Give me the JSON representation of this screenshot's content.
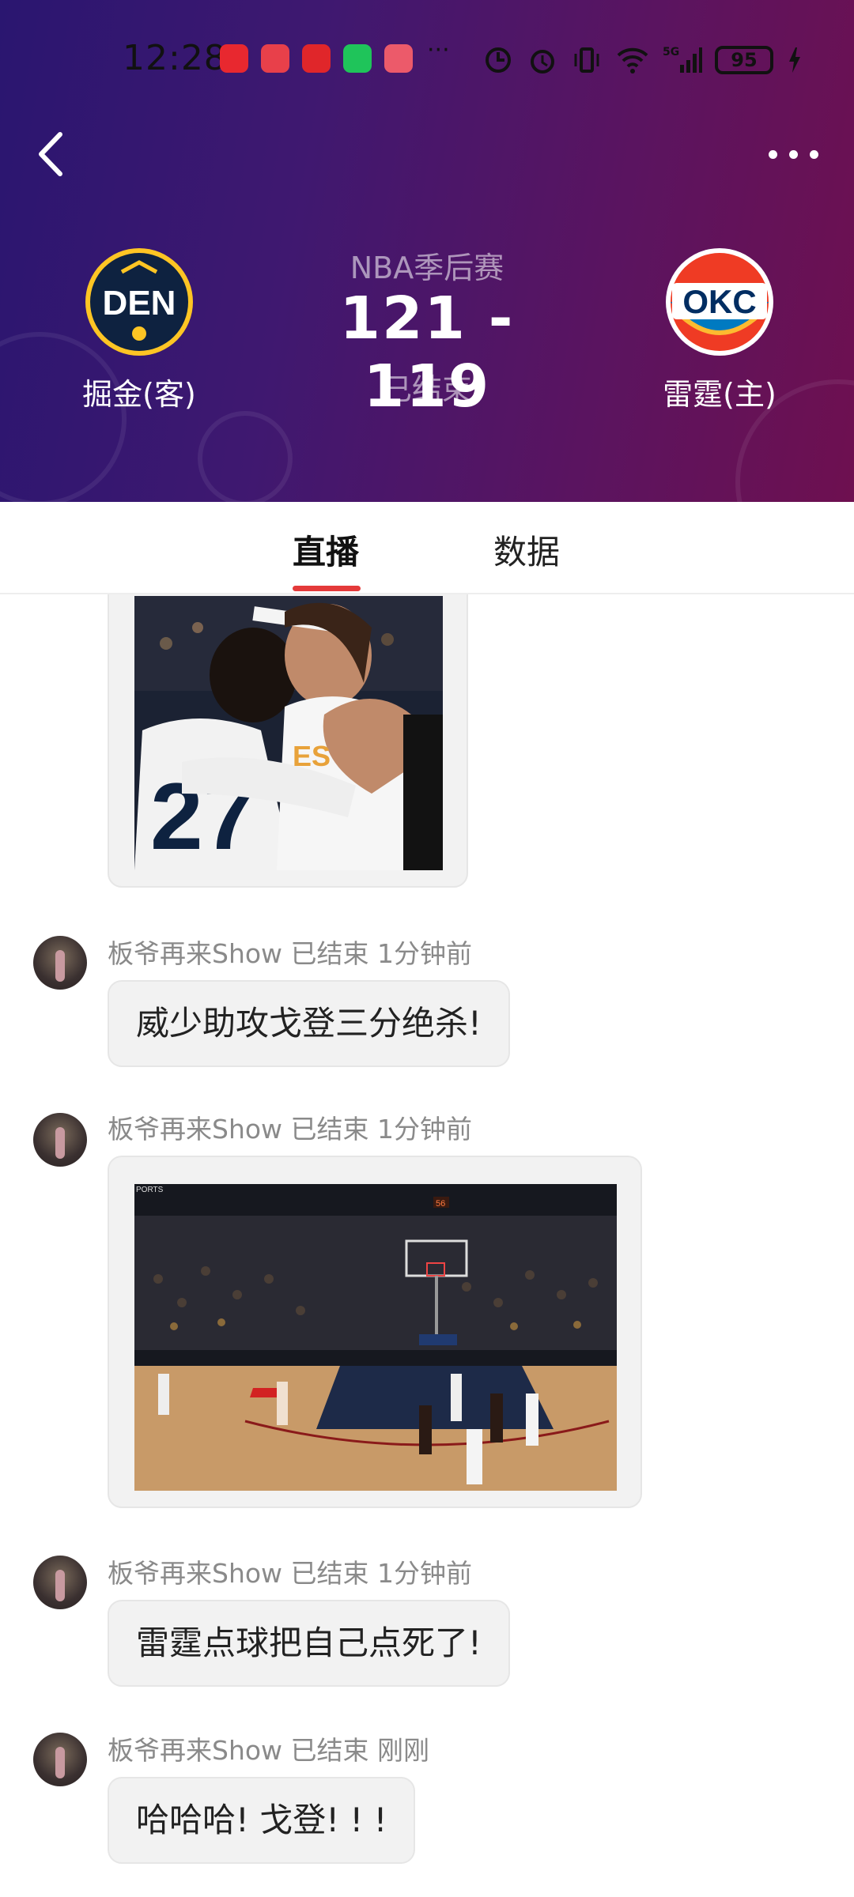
{
  "status_bar": {
    "time": "12:28",
    "dots": "···",
    "network": "5G",
    "battery": "95"
  },
  "header": {
    "league": "NBA季后赛",
    "score": "121 - 119",
    "status": "已结束",
    "away": {
      "abbr": "DEN",
      "name": "掘金(客)",
      "color": "#0e2240",
      "accent": "#fec524"
    },
    "home": {
      "abbr": "OKC",
      "name": "雷霆(主)",
      "color": "#ef3b24",
      "accent": "#007ac1"
    }
  },
  "tabs": [
    {
      "label": "直播",
      "active": true
    },
    {
      "label": "数据",
      "active": false
    }
  ],
  "messages": [
    {
      "type": "image",
      "description_icon": "video-thumbnail"
    },
    {
      "type": "text",
      "author": "板爷再来Show",
      "status": "已结束",
      "time": "1分钟前",
      "text": "威少助攻戈登三分绝杀!"
    },
    {
      "type": "image",
      "author": "板爷再来Show",
      "status": "已结束",
      "time": "1分钟前",
      "overlay_text": "56"
    },
    {
      "type": "text",
      "author": "板爷再来Show",
      "status": "已结束",
      "time": "1分钟前",
      "text": "雷霆点球把自己点死了!"
    },
    {
      "type": "text",
      "author": "板爷再来Show",
      "status": "已结束",
      "time": "刚刚",
      "text": "哈哈哈! 戈登! ! !"
    }
  ],
  "colors": {
    "accent": "#e43a3a",
    "header_left": "#2a1670",
    "header_right": "#6e1050"
  }
}
